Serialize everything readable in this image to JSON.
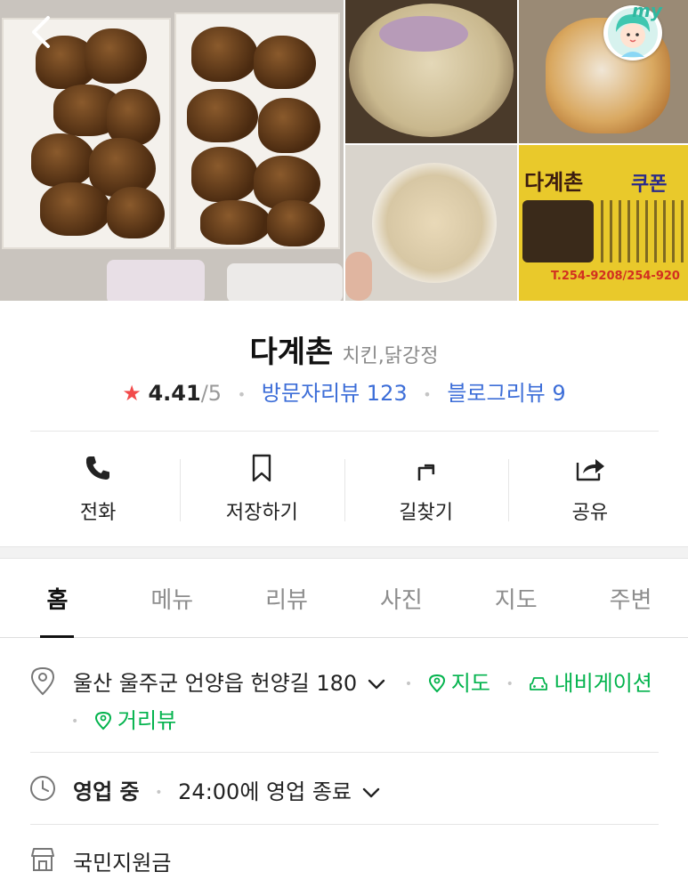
{
  "header": {
    "back_icon": "chevron-left-icon",
    "my_badge": "my"
  },
  "gallery": {
    "coupon": {
      "shop_name": "다계촌",
      "coupon_label": "쿠폰",
      "phone": "T.254-9208/254-920"
    }
  },
  "place": {
    "name": "다계촌",
    "category": "치킨,닭강정",
    "rating": "4.41",
    "rating_max": "/5",
    "visitor_reviews": "방문자리뷰 123",
    "blog_reviews": "블로그리뷰 9"
  },
  "actions": [
    {
      "label": "전화",
      "icon": "phone-icon"
    },
    {
      "label": "저장하기",
      "icon": "bookmark-icon"
    },
    {
      "label": "길찾기",
      "icon": "directions-icon"
    },
    {
      "label": "공유",
      "icon": "share-icon"
    }
  ],
  "tabs": [
    {
      "label": "홈",
      "active": true
    },
    {
      "label": "메뉴",
      "active": false
    },
    {
      "label": "리뷰",
      "active": false
    },
    {
      "label": "사진",
      "active": false
    },
    {
      "label": "지도",
      "active": false
    },
    {
      "label": "주변",
      "active": false
    }
  ],
  "details": {
    "address": "울산 울주군 언양읍 헌양길 180",
    "map_link": "지도",
    "navigation_link": "내비게이션",
    "street_view_link": "거리뷰",
    "status": "영업 중",
    "hours": "24:00에 영업 종료",
    "support_label": "국민지원금"
  },
  "colors": {
    "star": "#f24a4a",
    "link_blue": "#3d6ed8",
    "link_green": "#03b34d"
  }
}
